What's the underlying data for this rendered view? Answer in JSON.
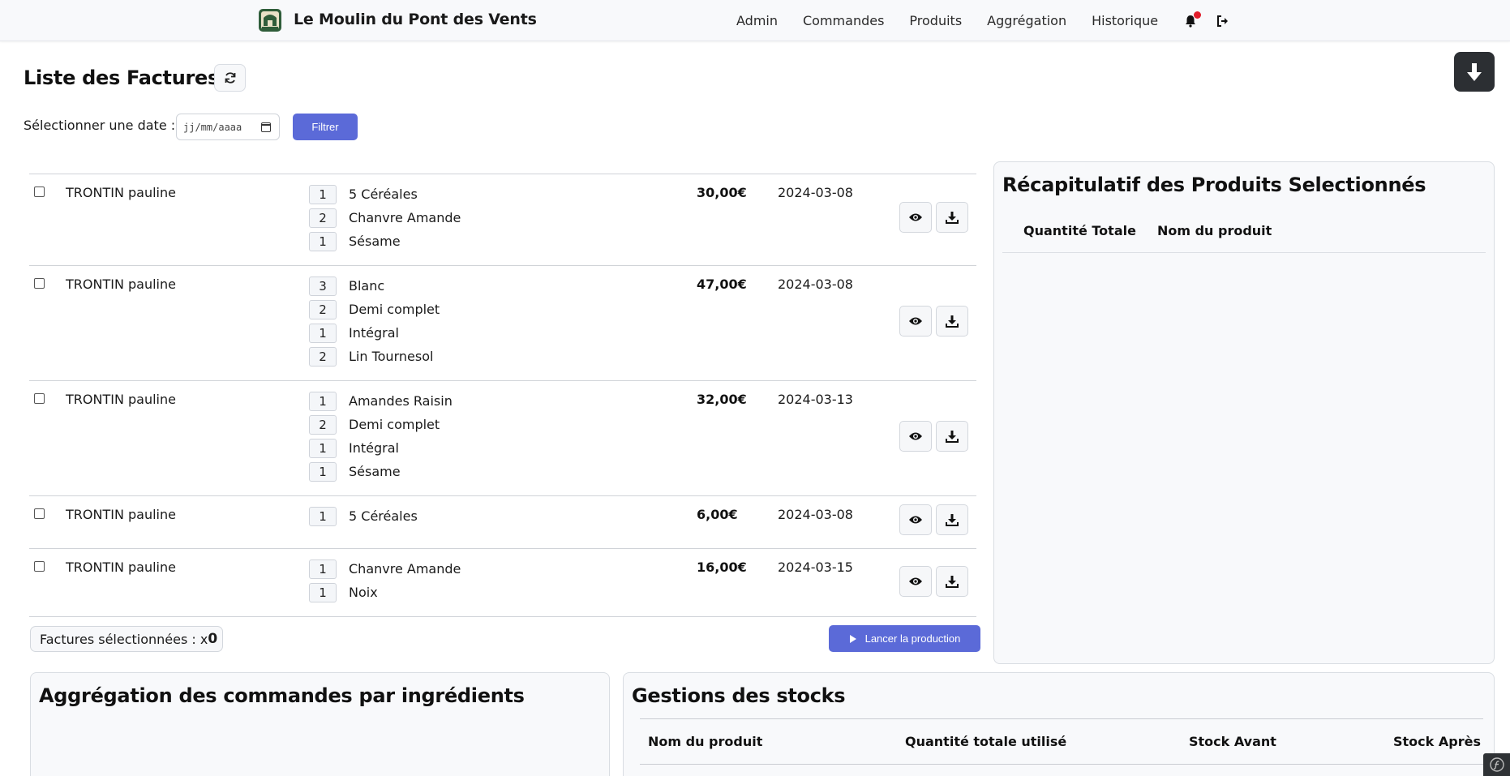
{
  "app": {
    "name": "Le Moulin du Pont des Vents"
  },
  "nav": {
    "links": [
      {
        "label": "Admin"
      },
      {
        "label": "Commandes"
      },
      {
        "label": "Produits"
      },
      {
        "label": "Aggrégation"
      },
      {
        "label": "Historique"
      }
    ],
    "icons": [
      "bell-icon",
      "logout-icon"
    ]
  },
  "page": {
    "title": "Liste des Factures",
    "date_label": "Sélectionner une date :",
    "date_placeholder": "jj/mm/aaaa",
    "filter_label": "Filtrer"
  },
  "invoices": [
    {
      "client": "TRONTIN pauline",
      "items": [
        {
          "qty": "1",
          "name": "5 Céréales"
        },
        {
          "qty": "2",
          "name": "Chanvre Amande"
        },
        {
          "qty": "1",
          "name": "Sésame"
        }
      ],
      "total": "30,00€",
      "date": "2024-03-08"
    },
    {
      "client": "TRONTIN pauline",
      "items": [
        {
          "qty": "3",
          "name": "Blanc"
        },
        {
          "qty": "2",
          "name": "Demi complet"
        },
        {
          "qty": "1",
          "name": "Intégral"
        },
        {
          "qty": "2",
          "name": "Lin Tournesol"
        }
      ],
      "total": "47,00€",
      "date": "2024-03-08"
    },
    {
      "client": "TRONTIN pauline",
      "items": [
        {
          "qty": "1",
          "name": "Amandes Raisin"
        },
        {
          "qty": "2",
          "name": "Demi complet"
        },
        {
          "qty": "1",
          "name": "Intégral"
        },
        {
          "qty": "1",
          "name": "Sésame"
        }
      ],
      "total": "32,00€",
      "date": "2024-03-13"
    },
    {
      "client": "TRONTIN pauline",
      "items": [
        {
          "qty": "1",
          "name": "5 Céréales"
        }
      ],
      "total": "6,00€",
      "date": "2024-03-08"
    },
    {
      "client": "TRONTIN pauline",
      "items": [
        {
          "qty": "1",
          "name": "Chanvre Amande"
        },
        {
          "qty": "1",
          "name": "Noix"
        }
      ],
      "total": "16,00€",
      "date": "2024-03-15"
    }
  ],
  "footer": {
    "selected_label": "Factures sélectionnées : x",
    "selected_count": "0",
    "launch_label": "Lancer la production"
  },
  "recap": {
    "title": "Récapitulatif des Produits Selectionnés",
    "col_qty": "Quantité Totale",
    "col_name": "Nom du produit"
  },
  "aggregation": {
    "title": "Aggrégation des commandes par ingrédients"
  },
  "stock": {
    "title": "Gestions des stocks",
    "columns": [
      "Nom du produit",
      "Quantité totale utilisé",
      "Stock Avant",
      "Stock Après"
    ]
  },
  "colors": {
    "primary": "#5b6ad8",
    "dark": "#2c2f33",
    "notification": "#e11d2a"
  }
}
